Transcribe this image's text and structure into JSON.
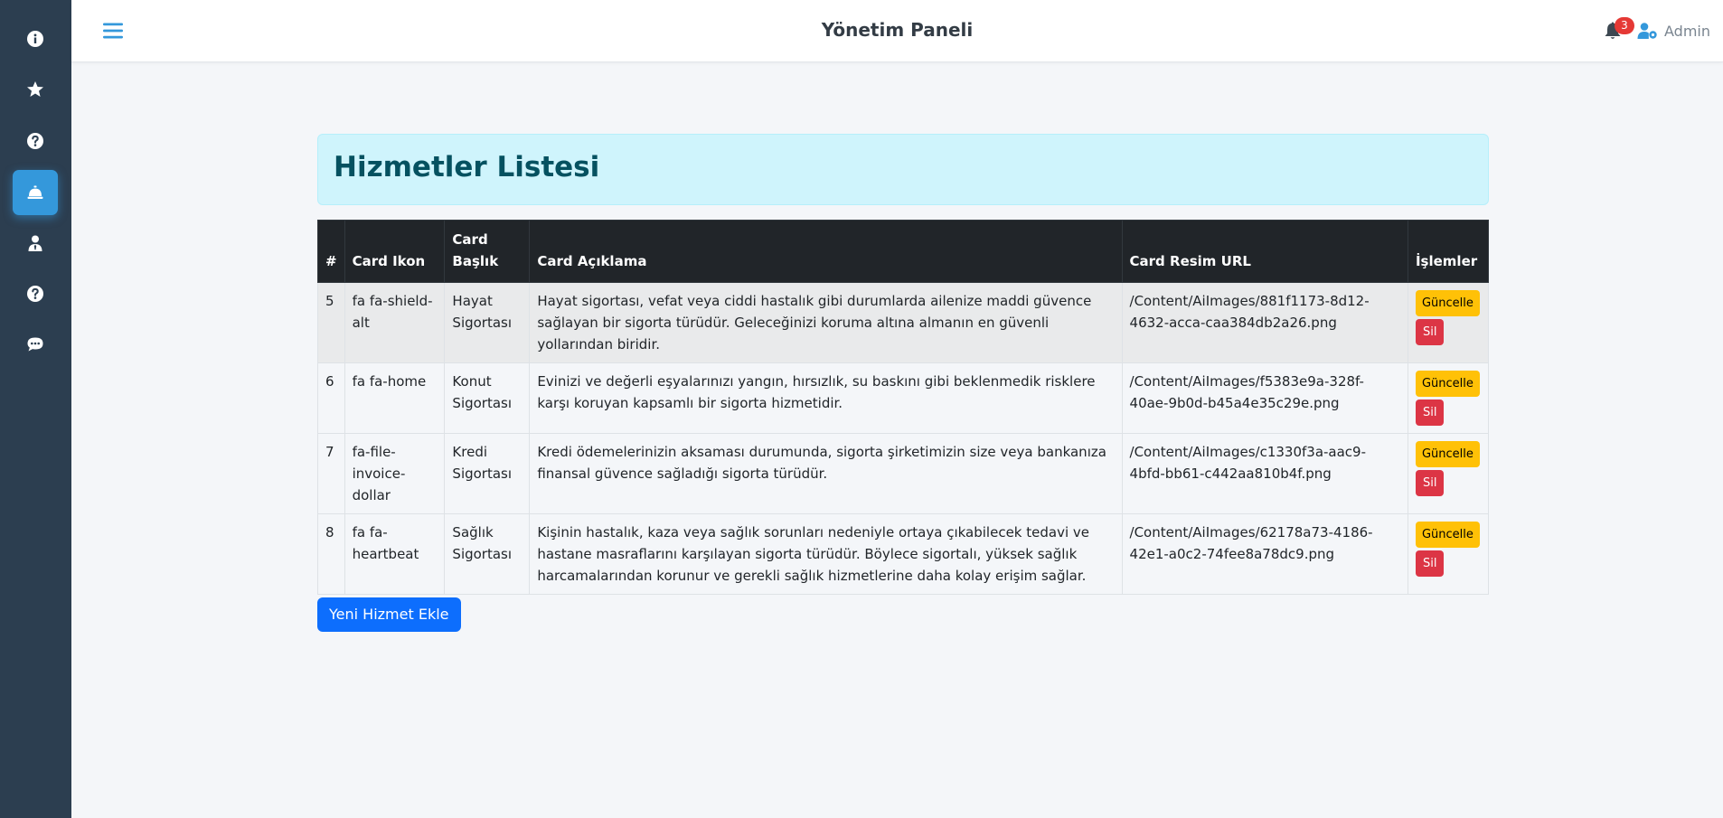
{
  "header": {
    "title": "Yönetim Paneli",
    "notification_count": "3",
    "user_label": "Admin"
  },
  "sidebar": {
    "items": [
      {
        "icon": "info-icon"
      },
      {
        "icon": "star-icon"
      },
      {
        "icon": "question-icon"
      },
      {
        "icon": "concierge-bell-icon",
        "active": true
      },
      {
        "icon": "user-tie-icon"
      },
      {
        "icon": "question-icon"
      },
      {
        "icon": "comment-dots-icon"
      }
    ]
  },
  "main": {
    "title": "Hizmetler Listesi",
    "table": {
      "headers": {
        "num": "#",
        "icon": "Card Ikon",
        "title_line1": "Card",
        "title_line2": "Başlık",
        "desc": "Card Açıklama",
        "url": "Card Resim URL",
        "actions": "İşlemler"
      },
      "rows": [
        {
          "num": "5",
          "icon": "fa fa-shield-alt",
          "title": "Hayat Sigortası",
          "desc": "Hayat sigortası, vefat veya ciddi hastalık gibi durumlarda ailenize maddi güvence sağlayan bir sigorta türüdür. Geleceğinizi koruma altına almanın en güvenli yollarından biridir.",
          "url": "/Content/AiImages/881f1173-8d12-4632-acca-caa384db2a26.png"
        },
        {
          "num": "6",
          "icon": "fa fa-home",
          "title": "Konut Sigortası",
          "desc": "Evinizi ve değerli eşyalarınızı yangın, hırsızlık, su baskını gibi beklenmedik risklere karşı koruyan kapsamlı bir sigorta hizmetidir.",
          "url": "/Content/AiImages/f5383e9a-328f-40ae-9b0d-b45a4e35c29e.png"
        },
        {
          "num": "7",
          "icon": "fa-file-invoice-dollar",
          "title": "Kredi Sigortası",
          "desc": "Kredi ödemelerinizin aksaması durumunda, sigorta şirketimizin size veya bankanıza finansal güvence sağladığı sigorta türüdür.",
          "url": "/Content/AiImages/c1330f3a-aac9-4bfd-bb61-c442aa810b4f.png"
        },
        {
          "num": "8",
          "icon": "fa fa-heartbeat",
          "title": "Sağlık Sigortası",
          "desc": "Kişinin hastalık, kaza veya sağlık sorunları nedeniyle ortaya çıkabilecek tedavi ve hastane masraflarını karşılayan sigorta türüdür. Böylece sigortalı, yüksek sağlık harcamalarından korunur ve gerekli sağlık hizmetlerine daha kolay erişim sağlar.",
          "url": "/Content/AiImages/62178a73-4186-42e1-a0c2-74fee8a78dc9.png"
        }
      ],
      "update_label": "Güncelle",
      "delete_label": "Sil"
    },
    "add_button": "Yeni Hizmet Ekle"
  },
  "colors": {
    "sidebar_bg": "#2c3e50",
    "sidebar_active": "#3498db",
    "accent": "#3498db",
    "header_alert_bg": "#cff4fc",
    "header_alert_text": "#055160",
    "table_head": "#212529",
    "warning": "#ffc107",
    "danger": "#dc3545",
    "primary": "#0d6efd",
    "badge": "#e53935"
  }
}
